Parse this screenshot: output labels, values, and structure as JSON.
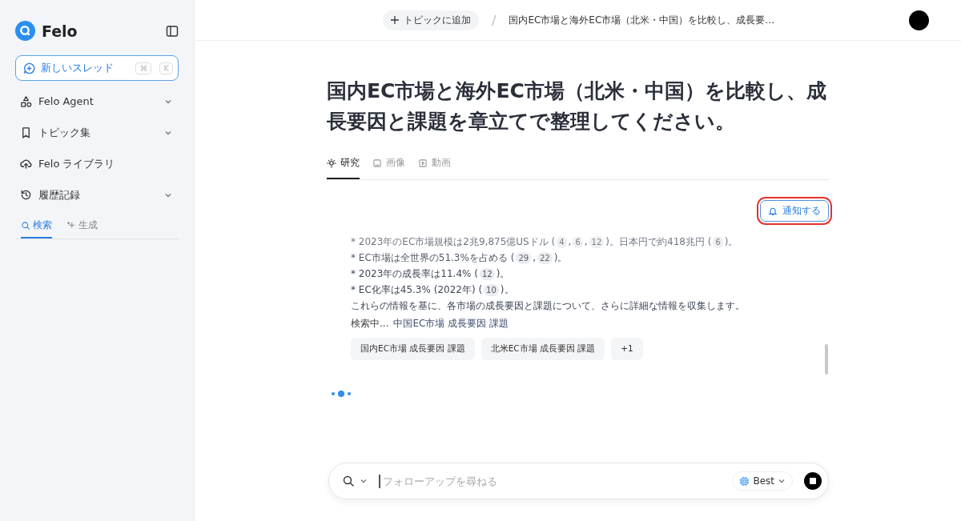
{
  "sidebar": {
    "brand": "Felo",
    "new_thread": {
      "label": "新しいスレッド",
      "keys": [
        "⌘",
        "K"
      ]
    },
    "items": [
      {
        "label": "Felo Agent",
        "expandable": true
      },
      {
        "label": "トピック集",
        "expandable": true
      },
      {
        "label": "Felo ライブラリ",
        "expandable": false
      },
      {
        "label": "履歴記録",
        "expandable": true
      }
    ],
    "history_tabs": [
      {
        "label": "検索",
        "selected": true
      },
      {
        "label": "生成",
        "selected": false
      }
    ]
  },
  "topbar": {
    "add_topic": "トピックに追加",
    "separator": "/",
    "thread_title": "国内EC市場と海外EC市場（北米・中国）を比較し、成長要…"
  },
  "question": "国内EC市場と海外EC市場（北米・中国）を比較し、成長要因と課題を章立てで整理してください。",
  "tabs": [
    {
      "label": "研究",
      "selected": true
    },
    {
      "label": "画像",
      "selected": false
    },
    {
      "label": "動画",
      "selected": false
    }
  ],
  "notify_button": {
    "label": "通知する",
    "highlighted": true
  },
  "progress_lines": [
    [
      {
        "kind": "text",
        "text": "* 2023年のEC市場規模は2兆9,875億USドル ("
      },
      {
        "kind": "cite",
        "text": "4"
      },
      {
        "kind": "text",
        "text": ","
      },
      {
        "kind": "cite",
        "text": "6"
      },
      {
        "kind": "text",
        "text": ","
      },
      {
        "kind": "cite",
        "text": "12"
      },
      {
        "kind": "text",
        "text": ")。日本円で約418兆円 ("
      },
      {
        "kind": "cite",
        "text": "6"
      },
      {
        "kind": "text",
        "text": ")。"
      }
    ],
    [
      {
        "kind": "text",
        "text": "* EC市場は全世界の51.3%を占める ("
      },
      {
        "kind": "cite",
        "text": "29"
      },
      {
        "kind": "text",
        "text": ","
      },
      {
        "kind": "cite",
        "text": "22"
      },
      {
        "kind": "text",
        "text": ")。"
      }
    ],
    [
      {
        "kind": "text",
        "text": "* 2023年の成長率は11.4% ("
      },
      {
        "kind": "cite",
        "text": "12"
      },
      {
        "kind": "text",
        "text": ")。"
      }
    ],
    [
      {
        "kind": "text",
        "text": "* EC化率は45.3% (2022年) ("
      },
      {
        "kind": "cite",
        "text": "10"
      },
      {
        "kind": "text",
        "text": ")。"
      }
    ],
    [
      {
        "kind": "text",
        "text": "これらの情報を基に、各市場の成長要因と課題について、さらに詳細な情報を収集します。"
      }
    ]
  ],
  "searching": {
    "label": "検索中...",
    "query": "中国EC市場 成長要因 課題"
  },
  "query_chips": [
    "国内EC市場 成長要因 課題",
    "北米EC市場 成長要因 課題",
    "+1"
  ],
  "input": {
    "placeholder": "フォローアップを尋ねる",
    "model": "Best"
  }
}
